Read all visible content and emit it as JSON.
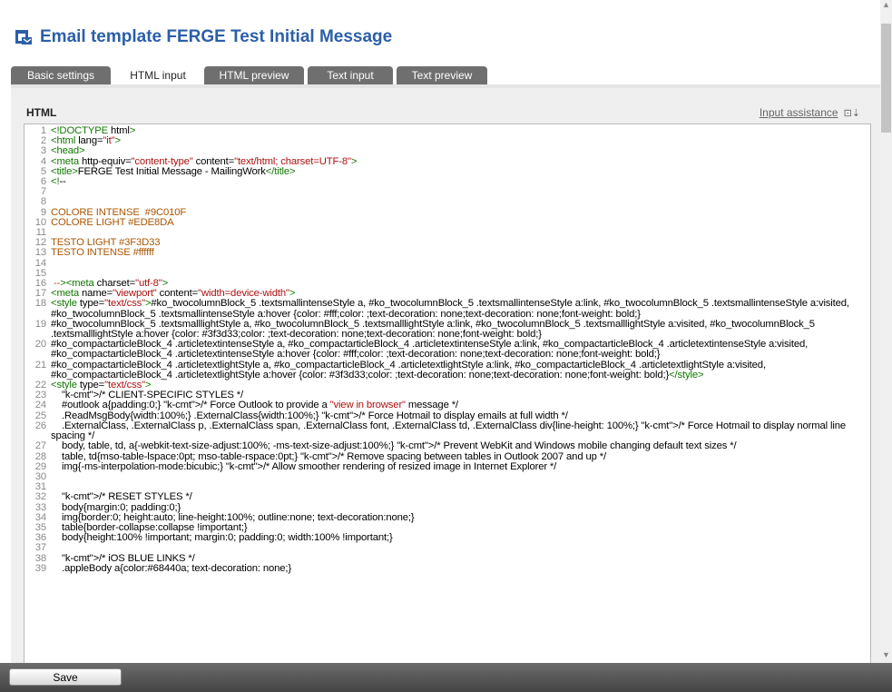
{
  "header": {
    "title": "Email template FERGE Test Initial Message",
    "icon": "email-template-icon"
  },
  "tabs": [
    {
      "label": "Basic settings",
      "active": false
    },
    {
      "label": "HTML input",
      "active": true
    },
    {
      "label": "HTML preview",
      "active": false
    },
    {
      "label": "Text input",
      "active": false
    },
    {
      "label": "Text preview",
      "active": false
    }
  ],
  "editor": {
    "label": "HTML",
    "assist_label": "Input assistance",
    "assist_icon": "input-assistance-icon",
    "lines": [
      {
        "n": "1",
        "t": "<!DOCTYPE html>"
      },
      {
        "n": "2",
        "t": "<html lang=\"it\">"
      },
      {
        "n": "3",
        "t": "<head>"
      },
      {
        "n": "4",
        "t": "<meta http-equiv=\"content-type\" content=\"text/html; charset=UTF-8\">"
      },
      {
        "n": "5",
        "t": "<title>FERGE Test Initial Message - MailingWork</title>"
      },
      {
        "n": "6",
        "t": "<!--"
      },
      {
        "n": "7",
        "t": ""
      },
      {
        "n": "8",
        "t": ""
      },
      {
        "n": "9",
        "t": "COLORE INTENSE  #9C010F"
      },
      {
        "n": "10",
        "t": "COLORE LIGHT #EDE8DA"
      },
      {
        "n": "11",
        "t": ""
      },
      {
        "n": "12",
        "t": "TESTO LIGHT #3F3D33"
      },
      {
        "n": "13",
        "t": "TESTO INTENSE #ffffff"
      },
      {
        "n": "14",
        "t": ""
      },
      {
        "n": "15",
        "t": ""
      },
      {
        "n": "16",
        "t": " --><meta charset=\"utf-8\">"
      },
      {
        "n": "17",
        "t": "<meta name=\"viewport\" content=\"width=device-width\">"
      },
      {
        "n": "18",
        "t": "<style type=\"text/css\">#ko_twocolumnBlock_5 .textsmallintenseStyle a, #ko_twocolumnBlock_5 .textsmallintenseStyle a:link, #ko_twocolumnBlock_5 .textsmallintenseStyle a:visited, #ko_twocolumnBlock_5 .textsmallintenseStyle a:hover {color: #fff;color: ;text-decoration: none;text-decoration: none;font-weight: bold;}"
      },
      {
        "n": "19",
        "t": "#ko_twocolumnBlock_5 .textsmalllightStyle a, #ko_twocolumnBlock_5 .textsmalllightStyle a:link, #ko_twocolumnBlock_5 .textsmalllightStyle a:visited, #ko_twocolumnBlock_5 .textsmalllightStyle a:hover {color: #3f3d33;color: ;text-decoration: none;text-decoration: none;font-weight: bold;}"
      },
      {
        "n": "20",
        "t": "#ko_compactarticleBlock_4 .articletextintenseStyle a, #ko_compactarticleBlock_4 .articletextintenseStyle a:link, #ko_compactarticleBlock_4 .articletextintenseStyle a:visited, #ko_compactarticleBlock_4 .articletextintenseStyle a:hover {color: #fff;color: ;text-decoration: none;text-decoration: none;font-weight: bold;}"
      },
      {
        "n": "21",
        "t": "#ko_compactarticleBlock_4 .articletextlightStyle a, #ko_compactarticleBlock_4 .articletextlightStyle a:link, #ko_compactarticleBlock_4 .articletextlightStyle a:visited, #ko_compactarticleBlock_4 .articletextlightStyle a:hover {color: #3f3d33;color: ;text-decoration: none;text-decoration: none;font-weight: bold;}</style>"
      },
      {
        "n": "22",
        "t": "<style type=\"text/css\">"
      },
      {
        "n": "23",
        "t": "    /* CLIENT-SPECIFIC STYLES */"
      },
      {
        "n": "24",
        "t": "    #outlook a{padding:0;} /* Force Outlook to provide a \"view in browser\" message */"
      },
      {
        "n": "25",
        "t": "    .ReadMsgBody{width:100%;} .ExternalClass{width:100%;} /* Force Hotmail to display emails at full width */"
      },
      {
        "n": "26",
        "t": "    .ExternalClass, .ExternalClass p, .ExternalClass span, .ExternalClass font, .ExternalClass td, .ExternalClass div{line-height: 100%;} /* Force Hotmail to display normal line spacing */"
      },
      {
        "n": "27",
        "t": "    body, table, td, a{-webkit-text-size-adjust:100%; -ms-text-size-adjust:100%;} /* Prevent WebKit and Windows mobile changing default text sizes */"
      },
      {
        "n": "28",
        "t": "    table, td{mso-table-lspace:0pt; mso-table-rspace:0pt;} /* Remove spacing between tables in Outlook 2007 and up */"
      },
      {
        "n": "29",
        "t": "    img{-ms-interpolation-mode:bicubic;} /* Allow smoother rendering of resized image in Internet Explorer */"
      },
      {
        "n": "30",
        "t": ""
      },
      {
        "n": "31",
        "t": ""
      },
      {
        "n": "32",
        "t": "    /* RESET STYLES */"
      },
      {
        "n": "33",
        "t": "    body{margin:0; padding:0;}"
      },
      {
        "n": "34",
        "t": "    img{border:0; height:auto; line-height:100%; outline:none; text-decoration:none;}"
      },
      {
        "n": "35",
        "t": "    table{border-collapse:collapse !important;}"
      },
      {
        "n": "36",
        "t": "    body{height:100% !important; margin:0; padding:0; width:100% !important;}"
      },
      {
        "n": "37",
        "t": ""
      },
      {
        "n": "38",
        "t": "    /* iOS BLUE LINKS */"
      },
      {
        "n": "39",
        "t": "    .appleBody a{color:#68440a; text-decoration: none;}"
      }
    ]
  },
  "footer": {
    "save_label": "Save"
  }
}
